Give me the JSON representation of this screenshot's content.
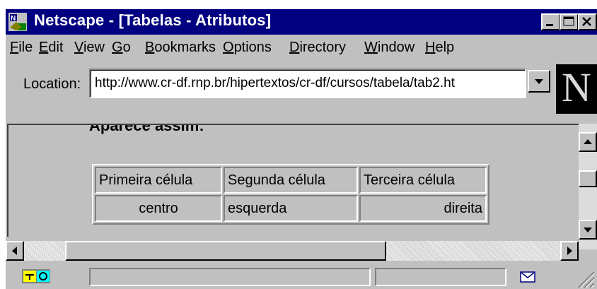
{
  "window": {
    "title": "Netscape - [Tabelas - Atributos]",
    "icon": "netscape-app-icon"
  },
  "menu": [
    {
      "label": "File"
    },
    {
      "label": "Edit"
    },
    {
      "label": "View"
    },
    {
      "label": "Go"
    },
    {
      "label": "Bookmarks"
    },
    {
      "label": "Options"
    },
    {
      "label": "Directory"
    },
    {
      "label": "Window"
    },
    {
      "label": "Help"
    }
  ],
  "location": {
    "label": "Location:",
    "url": "http://www.cr-df.rnp.br/hipertextos/cr-df/cursos/tabela/tab2.ht"
  },
  "logo": {
    "letter": "N"
  },
  "page": {
    "heading": "Aparece assim:",
    "table": [
      [
        "Primeira célula",
        "Segunda célula",
        "Terceira célula"
      ],
      [
        "centro",
        "esquerda",
        "direita"
      ]
    ],
    "alignments": [
      "center",
      "left",
      "right"
    ]
  },
  "colors": {
    "titlebar": "#000080",
    "chrome": "#c0c0c0"
  }
}
